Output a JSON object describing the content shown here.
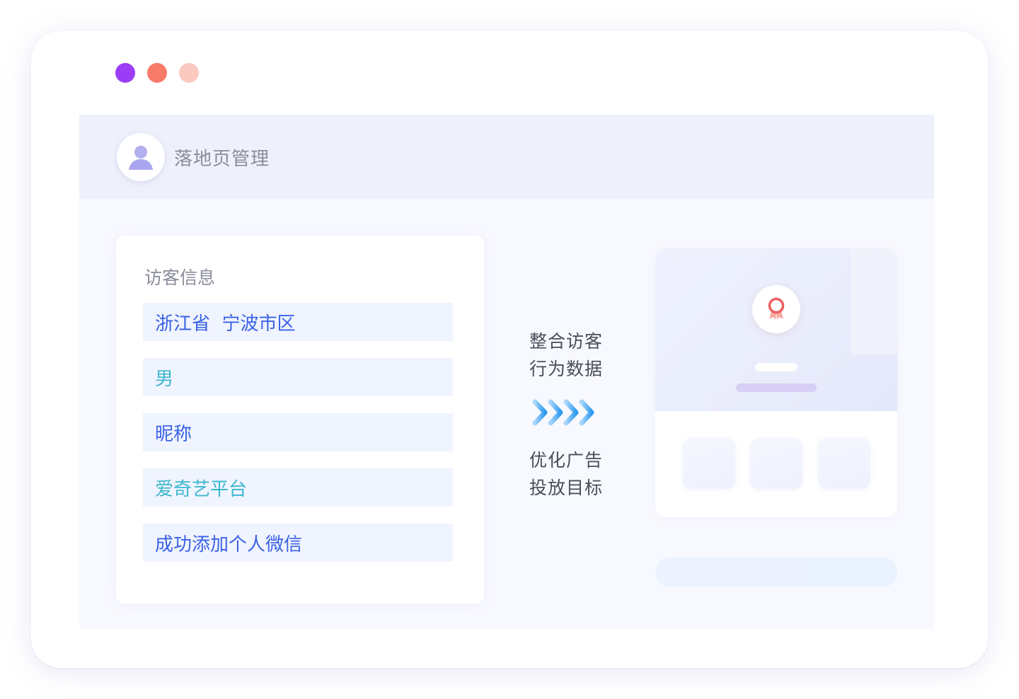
{
  "header": {
    "title": "落地页管理"
  },
  "visitor_info": {
    "title": "访客信息",
    "rows": [
      {
        "text": "浙江省  宁波市区",
        "color": "#3a62e6"
      },
      {
        "text": "男",
        "color": "#3bb7d0"
      },
      {
        "text": "昵称",
        "color": "#3a62e6"
      },
      {
        "text": "爱奇艺平台",
        "color": "#3bb7d0"
      },
      {
        "text": "成功添加个人微信",
        "color": "#3a62e6"
      }
    ]
  },
  "flow": {
    "integrate_line1": "整合访客",
    "integrate_line2": "行为数据",
    "optimize_line1": "优化广告",
    "optimize_line2": "投放目标",
    "arrow_icon": "chevron-right-icon"
  },
  "colors": {
    "window_dot_1": "#9b3cf7",
    "window_dot_2": "#f87a68",
    "window_dot_3": "#fbc9c0",
    "accent_blue": "#3a62e6",
    "accent_cyan": "#3bb7d0"
  },
  "icons": {
    "avatar": "user-icon",
    "medal": "medal-icon"
  }
}
